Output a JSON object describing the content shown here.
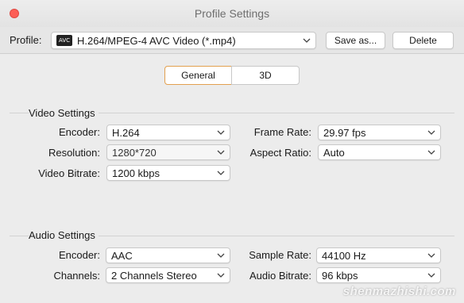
{
  "window": {
    "title": "Profile Settings"
  },
  "profile": {
    "label": "Profile:",
    "value": "H.264/MPEG-4 AVC Video (*.mp4)",
    "icon": "avc-icon",
    "icon_text": "AVC",
    "save_label": "Save as...",
    "delete_label": "Delete"
  },
  "tabs": [
    {
      "label": "General",
      "active": true
    },
    {
      "label": "3D",
      "active": false
    }
  ],
  "video": {
    "title": "Video Settings",
    "encoder": {
      "label": "Encoder:",
      "value": "H.264"
    },
    "resolution": {
      "label": "Resolution:",
      "value": "1280*720"
    },
    "bitrate": {
      "label": "Video Bitrate:",
      "value": "1200 kbps"
    },
    "frame_rate": {
      "label": "Frame Rate:",
      "value": "29.97 fps"
    },
    "aspect_ratio": {
      "label": "Aspect Ratio:",
      "value": "Auto"
    }
  },
  "audio": {
    "title": "Audio Settings",
    "encoder": {
      "label": "Encoder:",
      "value": "AAC"
    },
    "channels": {
      "label": "Channels:",
      "value": "2 Channels Stereo"
    },
    "sample_rate": {
      "label": "Sample Rate:",
      "value": "44100 Hz"
    },
    "bitrate": {
      "label": "Audio Bitrate:",
      "value": "96 kbps"
    }
  },
  "watermark": "shenmazhishi.com",
  "colors": {
    "close": "#fc5f57",
    "active_tab_border": "#e2a04f",
    "background": "#ececec"
  }
}
